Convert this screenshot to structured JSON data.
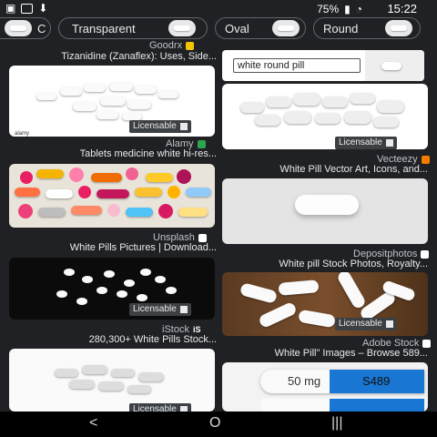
{
  "status_bar": {
    "time": "15:22",
    "battery": "75%"
  },
  "chips": [
    {
      "label": "Round"
    },
    {
      "label": "Oval"
    },
    {
      "label": "Transparent"
    },
    {
      "label": "C"
    }
  ],
  "search": {
    "query": "white round pill"
  },
  "badge": {
    "licensable": "Licensable"
  },
  "left_column": [
    {
      "source": "Goodrx",
      "title": "Tizanidine (Zanaflex): Uses, Side...",
      "favicon_color": "#f5c400"
    },
    {
      "source": "Alamy",
      "title": "Tablets medicine white hi-res...",
      "favicon_color": "#2ea44f"
    },
    {
      "source": "Unsplash",
      "title": "White Pills Pictures | Download...",
      "favicon_color": "#ffffff"
    },
    {
      "source": "iStock",
      "title": "280,300+ White Pills Stock...",
      "favicon_color": "#ffffff",
      "favicon_text": "iS"
    }
  ],
  "right_column": [
    {
      "source": "Vecteezy",
      "title": "White Pill Vector Art, Icons, and...",
      "favicon_color": "#f57c00"
    },
    {
      "source": "Depositphotos",
      "title": "White pill Stock Photos, Royalty...",
      "favicon_color": "#ffffff"
    },
    {
      "source": "Adobe Stock",
      "title": "White Pill\" Images – Browse 589...",
      "favicon_color": "#ffffff"
    }
  ],
  "capsule_labels": {
    "dose": "50 mg",
    "imprint": "S489"
  },
  "alamy_watermark": "alamy",
  "nav": {
    "back": "<",
    "home": "O",
    "recents": "|||"
  }
}
